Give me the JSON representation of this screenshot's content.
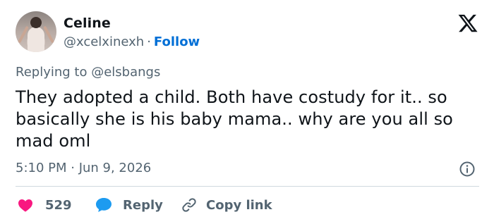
{
  "author": {
    "name": "Celine",
    "handle": "@xcelxinexh",
    "separator": "·",
    "follow_label": "Follow"
  },
  "reply_context": {
    "prefix": "Replying to ",
    "mention": "@elsbangs"
  },
  "tweet": {
    "text": "They adopted a child. Both have costudy for it.. so basically she is his baby mama.. why are you all so mad oml",
    "timestamp": "5:10 PM · Jun 9, 2026"
  },
  "actions": {
    "like_count": "529",
    "reply_label": "Reply",
    "copy_link_label": "Copy link"
  },
  "icons": {
    "brand": "x-logo-icon",
    "info": "info-icon",
    "like": "heart-icon",
    "reply": "speech-bubble-icon",
    "copy": "link-icon"
  },
  "colors": {
    "like": "#f91880",
    "reply": "#1d9bf0",
    "follow": "#006fd6",
    "secondary_text": "#536471"
  }
}
